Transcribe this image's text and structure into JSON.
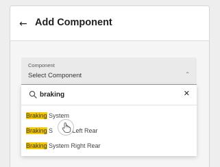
{
  "header": {
    "back_icon": "arrow-left-icon",
    "title": "Add Component"
  },
  "field": {
    "label": "Component",
    "value": "Select Component",
    "chevron_icon": "chevron-up-icon"
  },
  "search": {
    "icon": "search-icon",
    "value": "braking",
    "clear_icon": "close-icon"
  },
  "options": [
    {
      "highlight": "Braking",
      "rest": " System"
    },
    {
      "highlight": "Braking",
      "rest_before": " S",
      "rest_after": " Left Rear"
    },
    {
      "highlight": "Braking",
      "rest": " System Right Rear"
    }
  ],
  "colors": {
    "highlight": "#f5c800",
    "header_bg": "#ffffff",
    "panel_bg": "#f5f5f5"
  },
  "cursor_icon": "hand-pointer-icon"
}
